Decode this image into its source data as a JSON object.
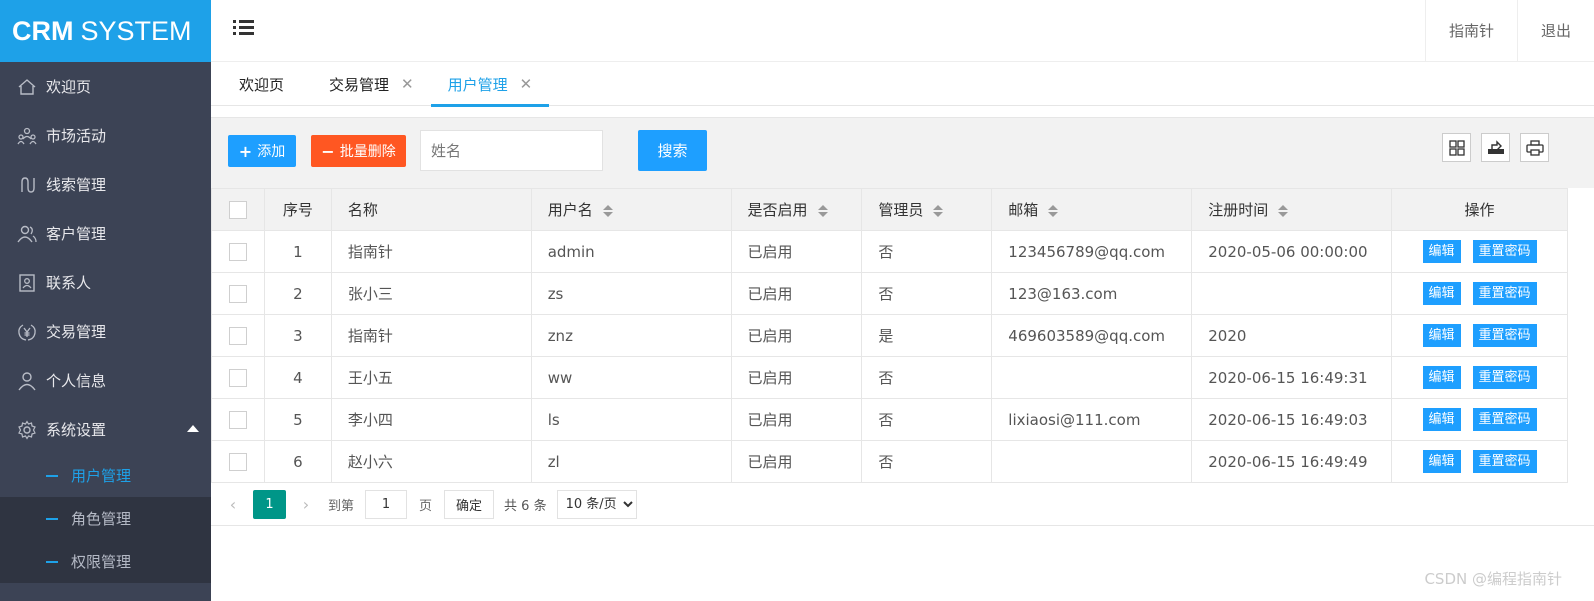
{
  "app": {
    "logo_bold": "CRM",
    "logo_rest": "SYSTEM"
  },
  "header": {
    "user": "指南针",
    "logout": "退出"
  },
  "sidebar": {
    "items": [
      {
        "label": "欢迎页",
        "icon": "home-icon"
      },
      {
        "label": "市场活动",
        "icon": "people-group-icon"
      },
      {
        "label": "线索管理",
        "icon": "connection-icon"
      },
      {
        "label": "客户管理",
        "icon": "users-icon"
      },
      {
        "label": "联系人",
        "icon": "contact-card-icon"
      },
      {
        "label": "交易管理",
        "icon": "yen-circle-icon"
      },
      {
        "label": "个人信息",
        "icon": "user-icon"
      },
      {
        "label": "系统设置",
        "icon": "gear-icon"
      }
    ],
    "sub_items": [
      {
        "label": "用户管理",
        "active": true
      },
      {
        "label": "角色管理"
      },
      {
        "label": "权限管理"
      }
    ]
  },
  "tabs": [
    {
      "label": "欢迎页"
    },
    {
      "label": "交易管理"
    },
    {
      "label": "用户管理",
      "active": true
    }
  ],
  "toolbar": {
    "add": "添加",
    "batch_delete": "批量删除",
    "search_placeholder": "姓名",
    "search": "搜索"
  },
  "table": {
    "headers": {
      "num": "序号",
      "name": "名称",
      "username": "用户名",
      "enabled": "是否启用",
      "admin": "管理员",
      "email": "邮箱",
      "reg_time": "注册时间",
      "actions": "操作"
    },
    "edit": "编辑",
    "reset_password": "重置密码",
    "rows": [
      {
        "num": "1",
        "name": "指南针",
        "username": "admin",
        "enabled": "已启用",
        "admin": "否",
        "email": "123456789@qq.com",
        "reg_time": "2020-05-06 00:00:00"
      },
      {
        "num": "2",
        "name": "张小三",
        "username": "zs",
        "enabled": "已启用",
        "admin": "否",
        "email": "123@163.com",
        "reg_time": ""
      },
      {
        "num": "3",
        "name": "指南针",
        "username": "znz",
        "enabled": "已启用",
        "admin": "是",
        "email": "469603589@qq.com",
        "reg_time": "2020"
      },
      {
        "num": "4",
        "name": "王小五",
        "username": "ww",
        "enabled": "已启用",
        "admin": "否",
        "email": "",
        "reg_time": "2020-06-15 16:49:31"
      },
      {
        "num": "5",
        "name": "李小四",
        "username": "ls",
        "enabled": "已启用",
        "admin": "否",
        "email": "lixiaosi@111.com",
        "reg_time": "2020-06-15 16:49:03"
      },
      {
        "num": "6",
        "name": "赵小六",
        "username": "zl",
        "enabled": "已启用",
        "admin": "否",
        "email": "",
        "reg_time": "2020-06-15 16:49:49"
      }
    ]
  },
  "pager": {
    "current": "1",
    "goto_label": "到第",
    "goto_value": "1",
    "page_unit": "页",
    "confirm": "确定",
    "total": "共 6 条",
    "page_size": "10 条/页"
  },
  "watermark": "CSDN @编程指南针"
}
